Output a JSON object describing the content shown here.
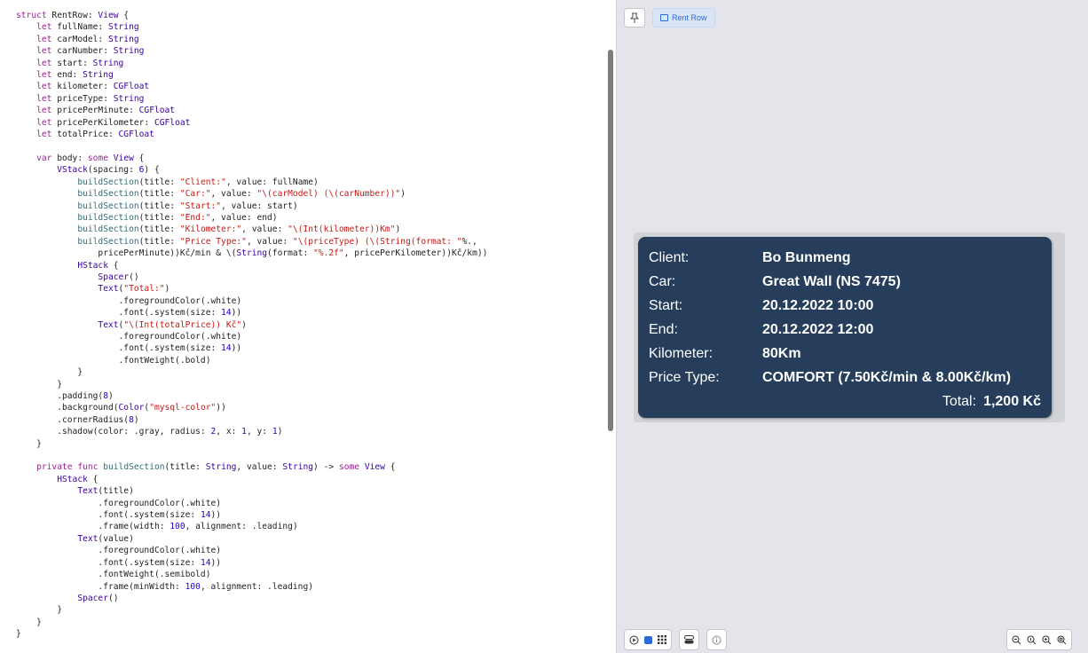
{
  "editor": {
    "language": "swift",
    "code_lines": [
      "struct RentRow: View {",
      "    let fullName: String",
      "    let carModel: String",
      "    let carNumber: String",
      "    let start: String",
      "    let end: String",
      "    let kilometer: CGFloat",
      "    let priceType: String",
      "    let pricePerMinute: CGFloat",
      "    let pricePerKilometer: CGFloat",
      "    let totalPrice: CGFloat",
      "",
      "    var body: some View {",
      "        VStack(spacing: 6) {",
      "            buildSection(title: \"Client:\", value: fullName)",
      "            buildSection(title: \"Car:\", value: \"\\(carModel) (\\(carNumber))\")",
      "            buildSection(title: \"Start:\", value: start)",
      "            buildSection(title: \"End:\", value: end)",
      "            buildSection(title: \"Kilometer:\", value: \"\\(Int(kilometer))Km\")",
      "            buildSection(title: \"Price Type:\", value: \"\\(priceType) (\\(String(format: \"%.2f\",",
      "                pricePerMinute))Kč/min & \\(String(format: \"%.2f\", pricePerKilometer))Kč/km)\")",
      "            HStack {",
      "                Spacer()",
      "                Text(\"Total:\")",
      "                    .foregroundColor(.white)",
      "                    .font(.system(size: 14))",
      "                Text(\"\\(Int(totalPrice)) Kč\")",
      "                    .foregroundColor(.white)",
      "                    .font(.system(size: 14))",
      "                    .fontWeight(.bold)",
      "            }",
      "        }",
      "        .padding(8)",
      "        .background(Color(\"mysql-color\"))",
      "        .cornerRadius(8)",
      "        .shadow(color: .gray, radius: 2, x: 1, y: 1)",
      "    }",
      "",
      "    private func buildSection(title: String, value: String) -> some View {",
      "        HStack {",
      "            Text(title)",
      "                .foregroundColor(.white)",
      "                .font(.system(size: 14))",
      "                .frame(width: 100, alignment: .leading)",
      "            Text(value)",
      "                .foregroundColor(.white)",
      "                .font(.system(size: 14))",
      "                .fontWeight(.semibold)",
      "                .frame(minWidth: 100, alignment: .leading)",
      "            Spacer()",
      "        }",
      "    }",
      "}"
    ]
  },
  "preview": {
    "tab_label": "Rent Row",
    "card": {
      "background_color": "#263e5b",
      "rows": [
        {
          "label": "Client:",
          "value": "Bo Bunmeng"
        },
        {
          "label": "Car:",
          "value": "Great Wall (NS 7475)"
        },
        {
          "label": "Start:",
          "value": "20.12.2022 10:00"
        },
        {
          "label": "End:",
          "value": "20.12.2022 12:00"
        },
        {
          "label": "Kilometer:",
          "value": "80Km"
        },
        {
          "label": "Price Type:",
          "value": "COMFORT (7.50Kč/min & 8.00Kč/km)"
        }
      ],
      "total_label": "Total:",
      "total_value": "1,200 Kč"
    },
    "icons": {
      "pin": "pin-icon",
      "play": "play-icon",
      "selectable": "selectable-mode-icon",
      "grid": "grid-variants-icon",
      "device_settings": "device-settings-icon",
      "info": "info-icon",
      "zoom": [
        "zoom-out-icon",
        "zoom-100-icon",
        "zoom-in-icon",
        "zoom-fit-icon"
      ]
    }
  }
}
